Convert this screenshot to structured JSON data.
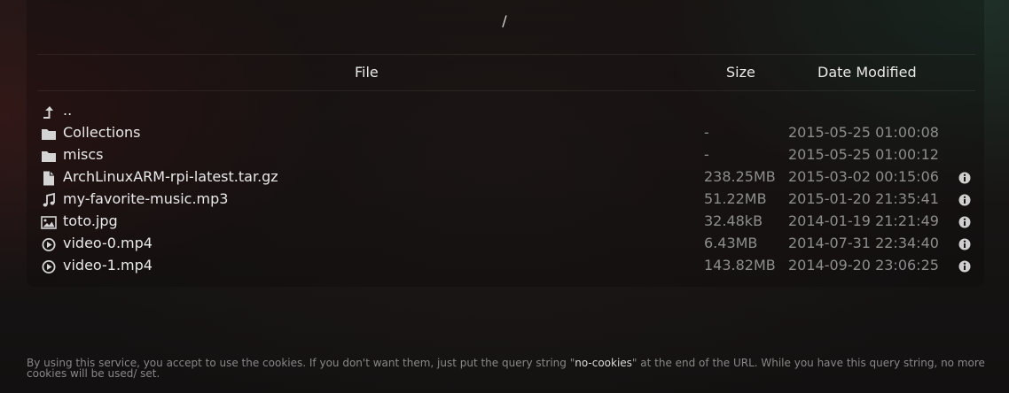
{
  "path": "/",
  "columns": {
    "file": "File",
    "size": "Size",
    "date": "Date Modified"
  },
  "rows": [
    {
      "icon": "parent-directory-icon",
      "name": "..",
      "size": "",
      "date": ""
    },
    {
      "icon": "folder-icon",
      "name": "Collections",
      "size": "-",
      "date": "2015-05-25 01:00:08"
    },
    {
      "icon": "folder-icon",
      "name": "miscs",
      "size": "-",
      "date": "2015-05-25 01:00:12"
    },
    {
      "icon": "file-icon",
      "name": "ArchLinuxARM-rpi-latest.tar.gz",
      "size": "238.25MB",
      "date": "2015-03-02 00:15:06"
    },
    {
      "icon": "music-icon",
      "name": "my-favorite-music.mp3",
      "size": "51.22MB",
      "date": "2015-01-20 21:35:41"
    },
    {
      "icon": "image-icon",
      "name": "toto.jpg",
      "size": "32.48kB",
      "date": "2014-01-19 21:21:49"
    },
    {
      "icon": "video-icon",
      "name": "video-0.mp4",
      "size": "6.43MB",
      "date": "2014-07-31 22:34:40"
    },
    {
      "icon": "video-icon",
      "name": "video-1.mp4",
      "size": "143.82MB",
      "date": "2014-09-20 23:06:25"
    }
  ],
  "footer": {
    "before": "By using this service, you accept to use the cookies. If you don't want them, just put the query string \"",
    "query": "no-cookies",
    "after": "\" at the end of the URL. While you have this query string, no more cookies will be used/ set."
  },
  "colors": {
    "text": "#e9e9e9",
    "muted": "#8d8d8d",
    "icon": "#d4d4d4"
  }
}
